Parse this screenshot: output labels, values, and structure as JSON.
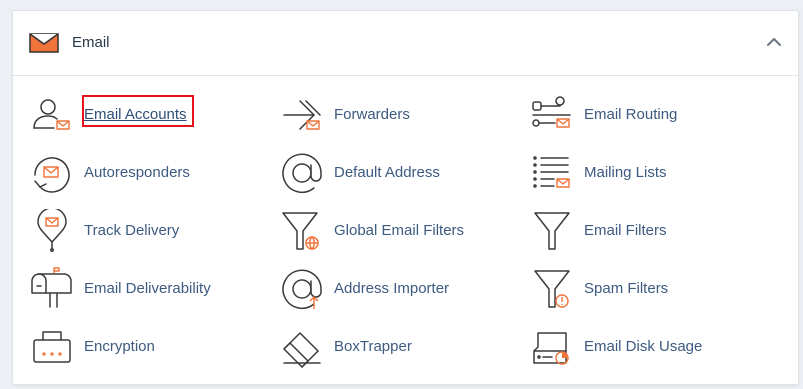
{
  "section": {
    "title": "Email",
    "accent_color": "#f0733a",
    "highlight_color": "#e3151a",
    "link_color": "#3d5a80"
  },
  "items": [
    {
      "label": "Email Accounts",
      "icon": "email-accounts-icon",
      "highlighted": true
    },
    {
      "label": "Forwarders",
      "icon": "forwarders-icon"
    },
    {
      "label": "Email Routing",
      "icon": "email-routing-icon"
    },
    {
      "label": "Autoresponders",
      "icon": "autoresponders-icon"
    },
    {
      "label": "Default Address",
      "icon": "default-address-icon"
    },
    {
      "label": "Mailing Lists",
      "icon": "mailing-lists-icon"
    },
    {
      "label": "Track Delivery",
      "icon": "track-delivery-icon"
    },
    {
      "label": "Global Email Filters",
      "icon": "global-email-filters-icon"
    },
    {
      "label": "Email Filters",
      "icon": "email-filters-icon"
    },
    {
      "label": "Email Deliverability",
      "icon": "email-deliverability-icon"
    },
    {
      "label": "Address Importer",
      "icon": "address-importer-icon"
    },
    {
      "label": "Spam Filters",
      "icon": "spam-filters-icon"
    },
    {
      "label": "Encryption",
      "icon": "encryption-icon"
    },
    {
      "label": "BoxTrapper",
      "icon": "boxtrapper-icon"
    },
    {
      "label": "Email Disk Usage",
      "icon": "email-disk-usage-icon"
    }
  ]
}
